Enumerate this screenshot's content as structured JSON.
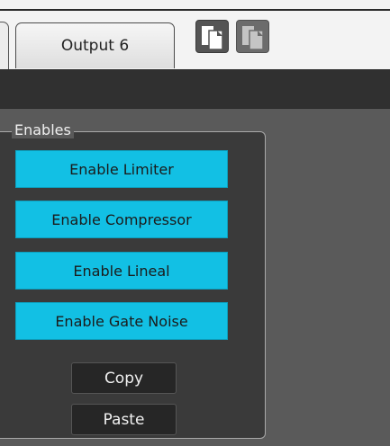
{
  "tabs": {
    "active_label": "Output 6"
  },
  "toolbar": {
    "copy_icon": "copy-pages-icon",
    "paste_icon": "paste-pages-icon"
  },
  "enables": {
    "legend": "Enables",
    "buttons": [
      "Enable Limiter",
      "Enable Compressor",
      "Enable Lineal",
      "Enable Gate Noise"
    ],
    "copy_label": "Copy",
    "paste_label": "Paste"
  },
  "colors": {
    "accent": "#12c0e4",
    "panel": "#3a3a3a",
    "background": "#5a5a5a"
  }
}
